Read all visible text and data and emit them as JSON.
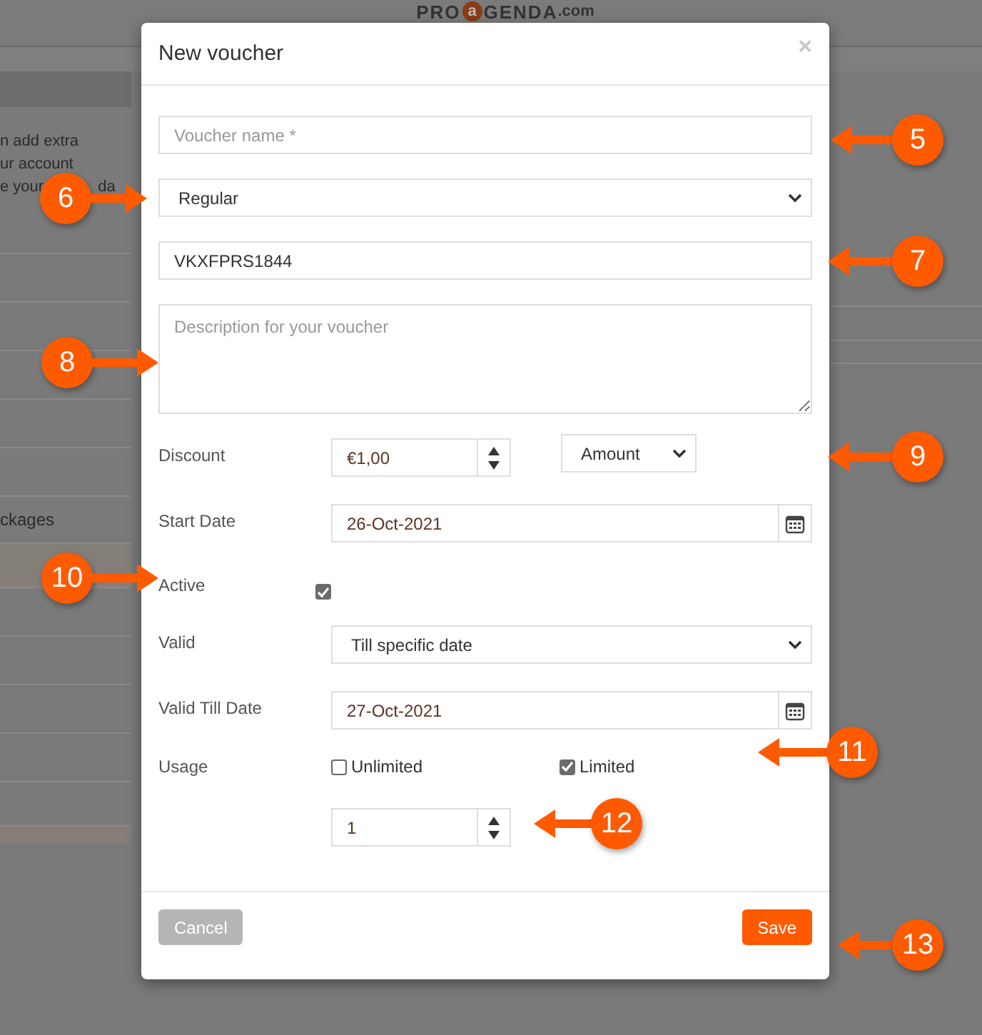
{
  "logo": {
    "prefix": "PRO",
    "mark": "a",
    "suffix": "GENDA",
    "domain": ".com"
  },
  "background": {
    "lines": [
      {
        "text": "n add extra"
      },
      {
        "text": "ur account"
      },
      {
        "text": "e your",
        "tail": "da"
      }
    ],
    "packages": "ckages"
  },
  "modal": {
    "title": "New voucher",
    "close": "×",
    "fields": [
      {
        "kind": "text",
        "placeholder": "Voucher name *"
      },
      {
        "kind": "select",
        "value": "Regular"
      },
      {
        "kind": "text",
        "value": "VKXFPRS1844"
      },
      {
        "kind": "textarea",
        "placeholder": "Description for your voucher"
      }
    ],
    "rows": [
      {
        "kind": "spin_select",
        "label": "Discount",
        "value": "€1,00",
        "unit": "Amount"
      },
      {
        "kind": "date",
        "label": "Start Date",
        "value": "26-Oct-2021"
      },
      {
        "kind": "checkbox",
        "label": "Active",
        "checked": true
      },
      {
        "kind": "select",
        "label": "Valid",
        "value": "Till specific date"
      },
      {
        "kind": "date",
        "label": "Valid Till Date",
        "value": "27-Oct-2021"
      },
      {
        "kind": "options",
        "label": "Usage",
        "options": [
          {
            "label": "Unlimited",
            "checked": false
          },
          {
            "label": "Limited",
            "checked": true
          }
        ]
      },
      {
        "kind": "spin",
        "value": "1"
      }
    ],
    "buttons": [
      {
        "kind": "secondary",
        "label": "Cancel"
      },
      {
        "kind": "primary",
        "label": "Save"
      }
    ]
  },
  "callouts": [
    {
      "number": "5"
    },
    {
      "number": "6"
    },
    {
      "number": "7"
    },
    {
      "number": "8"
    },
    {
      "number": "9"
    },
    {
      "number": "10"
    },
    {
      "number": "11"
    },
    {
      "number": "12"
    },
    {
      "number": "13"
    }
  ]
}
